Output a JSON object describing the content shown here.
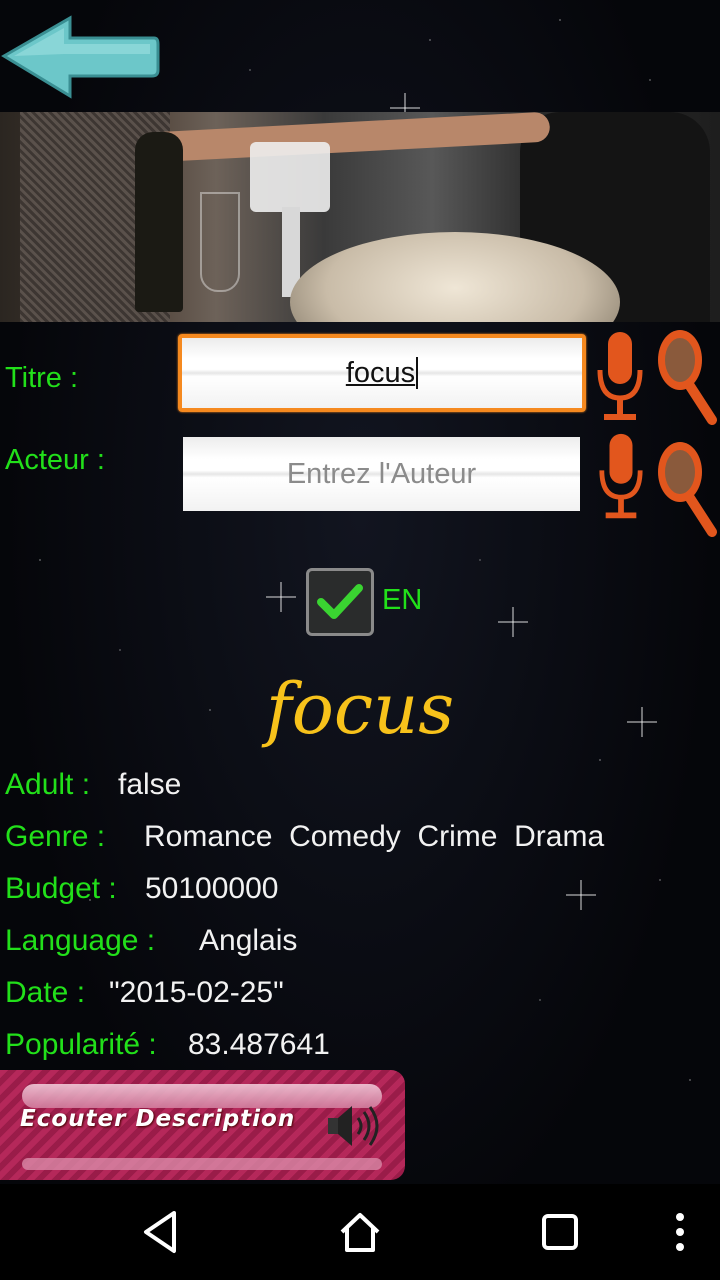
{
  "form": {
    "title_label": "Titre :",
    "title_value": "focus",
    "author_label": "Acteur :",
    "author_placeholder": "Entrez l'Auteur",
    "lang_checkbox_label": "EN",
    "lang_checked": true
  },
  "movie": {
    "title": "focus",
    "fields": [
      {
        "label": "Adult :",
        "value": "false"
      },
      {
        "label": "Genre :",
        "value": "Romance  Comedy  Crime  Drama"
      },
      {
        "label": "Budget :",
        "value": "50100000"
      },
      {
        "label": "Language :",
        "value": "Anglais"
      },
      {
        "label": "Date :",
        "value": "\"2015-02-25\""
      },
      {
        "label": "Popularité :",
        "value": "83.487641"
      }
    ]
  },
  "listen_button": {
    "label": "Ecouter Description"
  },
  "colors": {
    "label_green": "#22e01a",
    "title_gold": "#f7c21b",
    "focus_orange": "#f5891f",
    "icon_orange": "#e2561d",
    "button_pink": "#b5285a",
    "arrow_teal": "#6cc7c9"
  },
  "icons": [
    "back-arrow-icon",
    "microphone-icon",
    "magnifier-icon",
    "checkmark-icon",
    "speaker-icon",
    "nav-back-icon",
    "nav-home-icon",
    "nav-recents-icon",
    "overflow-menu-icon"
  ]
}
